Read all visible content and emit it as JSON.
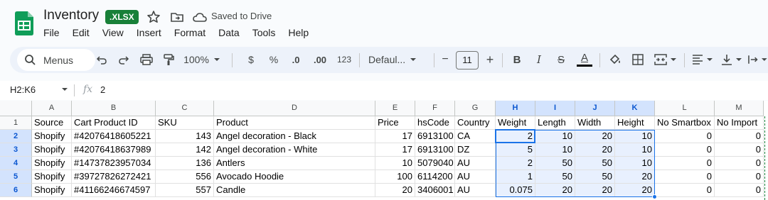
{
  "app": {
    "title": "Inventory",
    "badge": ".XLSX",
    "saved_status": "Saved to Drive",
    "brand_color": "#188038",
    "accent_color": "#1a73e8"
  },
  "menu": [
    "File",
    "Edit",
    "View",
    "Insert",
    "Format",
    "Data",
    "Tools",
    "Help"
  ],
  "toolbar": {
    "search_label": "Menus",
    "zoom": "100%",
    "currency": "$",
    "percent": "%",
    "decrease_decimal": ".0",
    "increase_decimal": ".00",
    "number_format": "123",
    "font": "Defaul...",
    "font_size": "11",
    "minus": "−",
    "plus": "+",
    "bold": "B",
    "italic": "I",
    "strike": "S",
    "text_color": "A",
    "icons": [
      "search-icon",
      "undo-icon",
      "redo-icon",
      "print-icon",
      "paint-format-icon",
      "bold-icon",
      "italic-icon",
      "strikethrough-icon",
      "text-color-icon",
      "fill-color-icon",
      "borders-icon",
      "merge-cells-icon",
      "align-icon",
      "vertical-align-icon",
      "text-direction-icon"
    ]
  },
  "formula_bar": {
    "name_box": "H2:K6",
    "fx": "fx",
    "value": "2"
  },
  "sheet": {
    "columns": [
      "A",
      "B",
      "C",
      "D",
      "E",
      "F",
      "G",
      "H",
      "I",
      "J",
      "K",
      "L",
      "M"
    ],
    "row_numbers": [
      "1",
      "2",
      "3",
      "4",
      "5",
      "6"
    ],
    "rows": [
      [
        "Source",
        "Cart Product ID",
        "SKU",
        "Product",
        "Price",
        "hsCode",
        "Country",
        "Weight",
        "Length",
        "Width",
        "Height",
        "No Smartbox",
        "No Import"
      ],
      [
        "Shopify",
        "#42076418605221",
        "143",
        "Angel decoration - Black",
        "17",
        "6913100",
        "CA",
        "2",
        "10",
        "20",
        "10",
        "0",
        "0"
      ],
      [
        "Shopify",
        "#42076418637989",
        "142",
        "Angel decoration - White",
        "17",
        "6913100",
        "DZ",
        "5",
        "10",
        "20",
        "10",
        "0",
        "0"
      ],
      [
        "Shopify",
        "#14737823957034",
        "136",
        "Antlers",
        "10",
        "5079040",
        "AU",
        "2",
        "50",
        "50",
        "10",
        "0",
        "0"
      ],
      [
        "Shopify",
        "#39727826272421",
        "556",
        "Avocado Hoodie",
        "100",
        "6114200",
        "AU",
        "1",
        "50",
        "50",
        "20",
        "0",
        "0"
      ],
      [
        "Shopify",
        "#41166246674597",
        "557",
        "Candle",
        "20",
        "3406001",
        "AU",
        "0.075",
        "20",
        "20",
        "20",
        "0",
        "0"
      ]
    ],
    "selection": "H2:K6"
  }
}
